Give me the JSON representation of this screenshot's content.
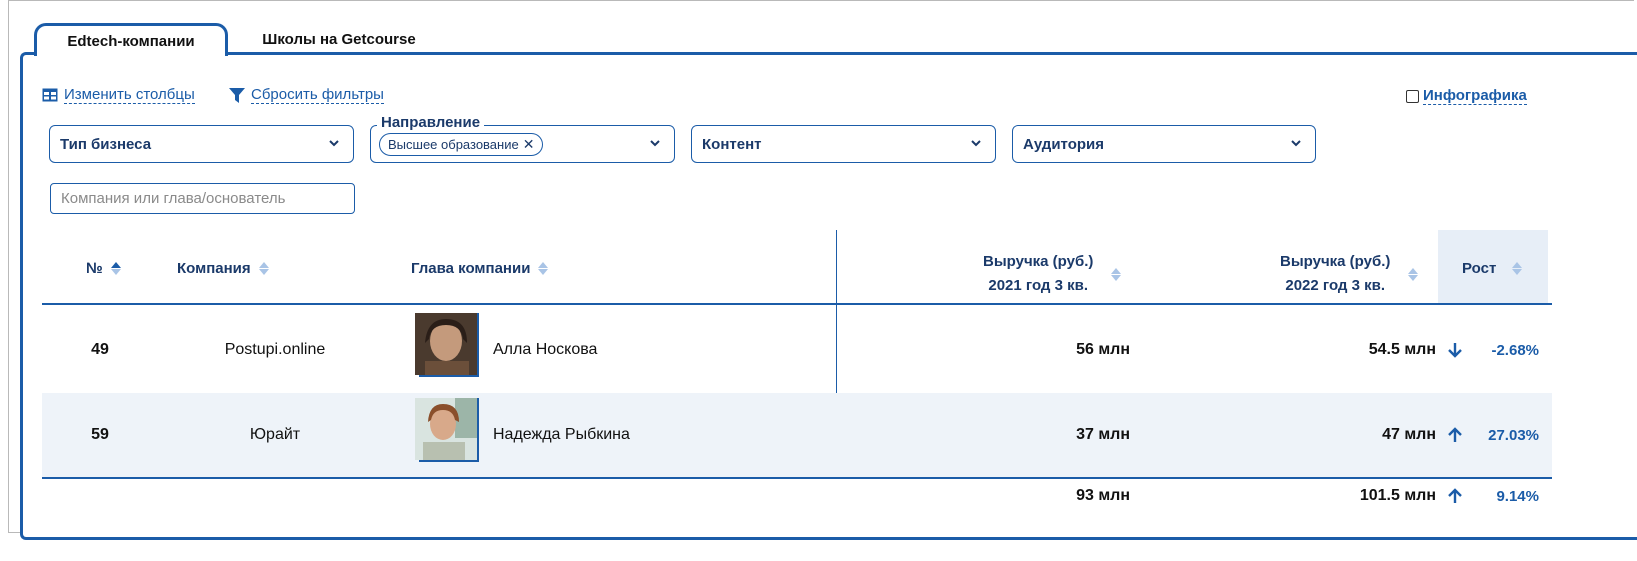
{
  "tabs": [
    {
      "label": "Edtech-компании",
      "active": true
    },
    {
      "label": "Школы на Getcourse",
      "active": false
    }
  ],
  "toolbar": {
    "change_columns": "Изменить столбцы",
    "reset_filters": "Сбросить фильтры",
    "infographics": "Инфографика"
  },
  "filters": {
    "business_type": "Тип бизнеса",
    "direction_legend": "Направление",
    "direction_chip": "Высшее образование",
    "content": "Контент",
    "audience": "Аудитория"
  },
  "search": {
    "placeholder": "Компания или глава/основатель",
    "value": ""
  },
  "table": {
    "headers": {
      "rank": "№",
      "company": "Компания",
      "head": "Глава компании",
      "rev2021_line1": "Выручка (руб.)",
      "rev2021_line2": "2021 год 3 кв.",
      "rev2022_line1": "Выручка (руб.)",
      "rev2022_line2": "2022 год 3 кв.",
      "growth": "Рост"
    },
    "rows": [
      {
        "rank": "49",
        "company": "Postupi.online",
        "head": "Алла Носкова",
        "rev2021": "56 млн",
        "rev2022": "54.5 млн",
        "trend": "down",
        "growth": "-2.68%"
      },
      {
        "rank": "59",
        "company": "Юрайт",
        "head": "Надежда Рыбкина",
        "rev2021": "37 млн",
        "rev2022": "47 млн",
        "trend": "up",
        "growth": "27.03%"
      }
    ],
    "total": {
      "rev2021": "93 млн",
      "rev2022": "101.5 млн",
      "trend": "up",
      "growth": "9.14%"
    }
  },
  "colors": {
    "accent": "#1b5ca8",
    "header_text": "#1b3a6a",
    "row_alt": "#eef3f9"
  }
}
